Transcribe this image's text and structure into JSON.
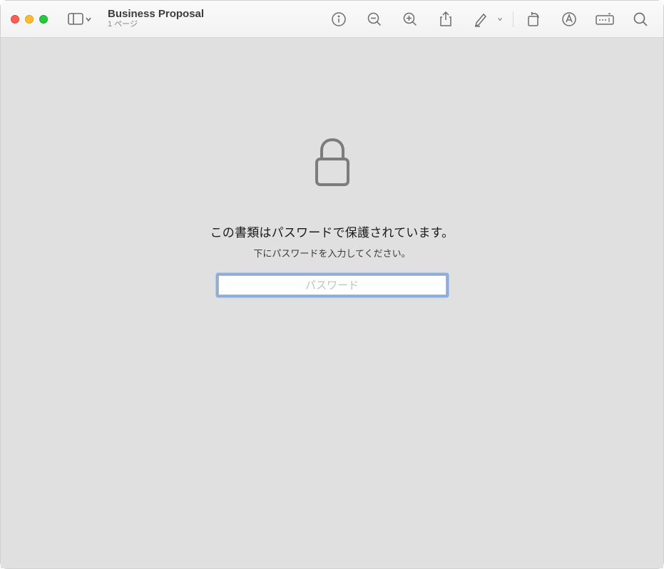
{
  "header": {
    "title": "Business Proposal",
    "subtitle": "1 ページ"
  },
  "toolbar": {
    "sidebar_toggle": "sidebar-toggle",
    "info": "info",
    "zoom_out": "zoom-out",
    "zoom_in": "zoom-in",
    "share": "share",
    "highlight": "highlight",
    "rotate": "rotate",
    "markup": "markup",
    "crop": "crop",
    "search": "search"
  },
  "lock_screen": {
    "heading": "この書類はパスワードで保護されています。",
    "subheading": "下にパスワードを入力してください。",
    "placeholder": "パスワード"
  }
}
